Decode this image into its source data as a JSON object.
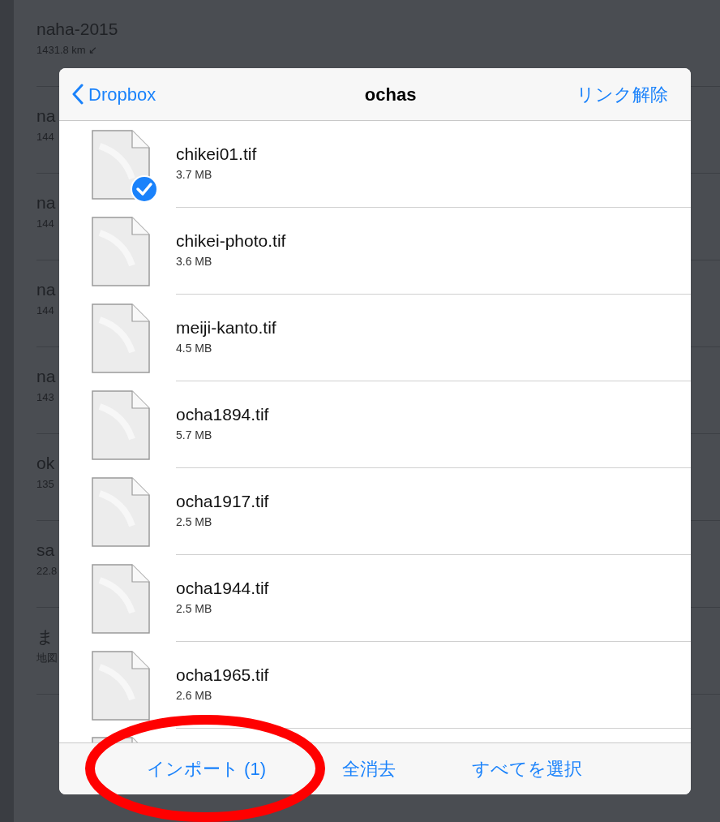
{
  "background_list": [
    {
      "name": "naha-2015",
      "detail": "1431.8 km ↙"
    },
    {
      "name": "na",
      "detail": "144"
    },
    {
      "name": "na",
      "detail": "144"
    },
    {
      "name": "na",
      "detail": "144"
    },
    {
      "name": "na",
      "detail": "143"
    },
    {
      "name": "ok",
      "detail": "135"
    },
    {
      "name": "sa",
      "detail": "22.8"
    },
    {
      "name": "ま",
      "detail": "地図"
    }
  ],
  "dialog": {
    "back_label": "Dropbox",
    "title": "ochas",
    "action": "リンク解除",
    "files": [
      {
        "name": "chikei01.tif",
        "size": "3.7 MB",
        "selected": true
      },
      {
        "name": "chikei-photo.tif",
        "size": "3.6 MB",
        "selected": false
      },
      {
        "name": "meiji-kanto.tif",
        "size": "4.5 MB",
        "selected": false
      },
      {
        "name": "ocha1894.tif",
        "size": "5.7 MB",
        "selected": false
      },
      {
        "name": "ocha1917.tif",
        "size": "2.5 MB",
        "selected": false
      },
      {
        "name": "ocha1944.tif",
        "size": "2.5 MB",
        "selected": false
      },
      {
        "name": "ocha1965.tif",
        "size": "2.6 MB",
        "selected": false
      }
    ],
    "toolbar": [
      "インポート (1)",
      "全消去",
      "すべてを選択"
    ]
  }
}
